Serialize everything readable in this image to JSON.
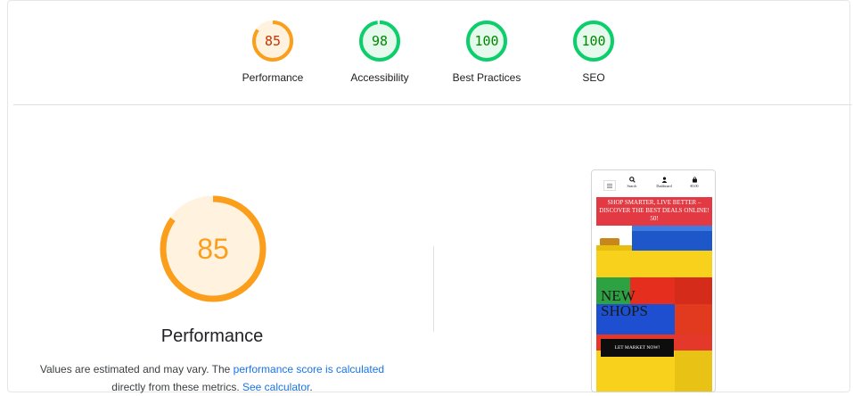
{
  "gauges": [
    {
      "label": "Performance",
      "score": "85",
      "color": "#fa9e1b",
      "text_color": "#c33300",
      "fill": "#fff3e0"
    },
    {
      "label": "Accessibility",
      "score": "98",
      "color": "#0cce6b",
      "text_color": "#008800",
      "fill": "#e6f9ed"
    },
    {
      "label": "Best Practices",
      "score": "100",
      "color": "#0cce6b",
      "text_color": "#008800",
      "fill": "#e6f9ed"
    },
    {
      "label": "SEO",
      "score": "100",
      "color": "#0cce6b",
      "text_color": "#008800",
      "fill": "#e6f9ed"
    }
  ],
  "main": {
    "score": "85",
    "score_fraction": 0.85,
    "title": "Performance",
    "desc_prefix": "Values are estimated and may vary. The ",
    "desc_link": "performance score is calculated",
    "desc_middle": " directly from these metrics. ",
    "desc_link2": "See calculator",
    "desc_suffix": "."
  },
  "screenshot": {
    "nav": {
      "search": "Search",
      "dashboard": "Dashboard",
      "cart": "€0.00"
    },
    "banner": "SHOP SMARTER, LIVE BETTER – DISCOVER THE BEST DEALS ONLINE! 50!",
    "hero_title": "NEW SHOPS",
    "hero_button": "LET MARKET NOW!"
  },
  "colors": {
    "orange": "#fa9e1b",
    "green": "#0cce6b",
    "link": "#1a73e8",
    "banner": "#e23942"
  }
}
